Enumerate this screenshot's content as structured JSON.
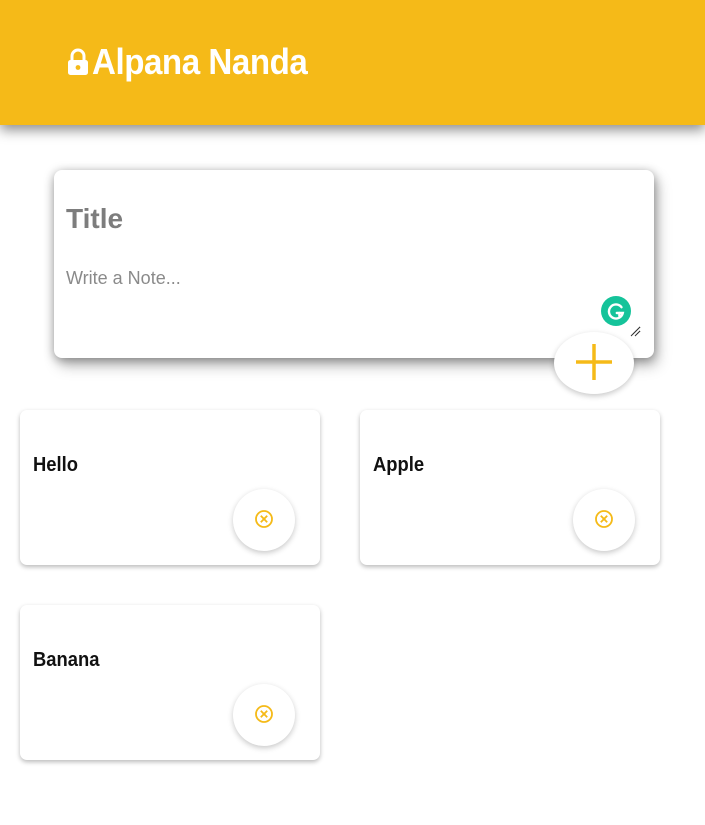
{
  "header": {
    "title": "Alpana Nanda",
    "icon": "lock-icon"
  },
  "composer": {
    "title_placeholder": "Title",
    "note_placeholder": "Write a Note...",
    "add_icon": "plus-icon"
  },
  "notes": [
    {
      "title": "Hello"
    },
    {
      "title": "Apple"
    },
    {
      "title": "Banana"
    }
  ],
  "colors": {
    "accent": "#f5ba18",
    "header_text": "#ffffff",
    "placeholder": "#7d7d7d",
    "grammarly": "#15c39a"
  }
}
